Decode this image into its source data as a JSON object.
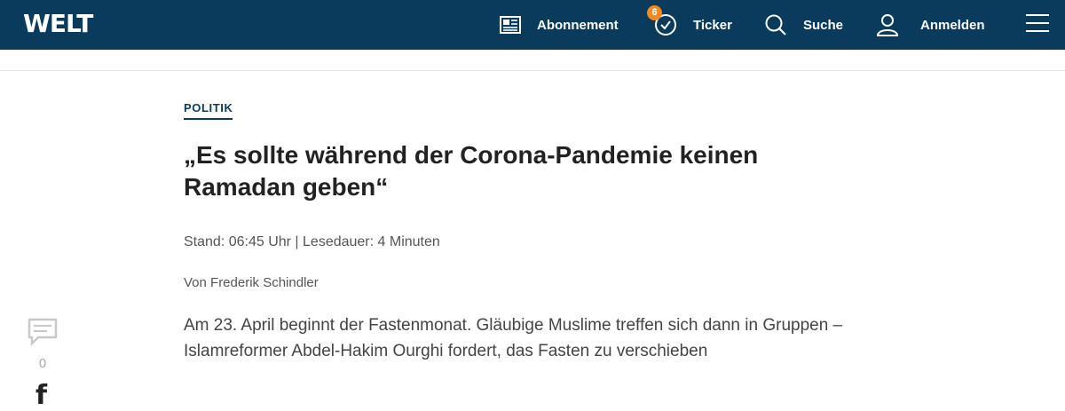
{
  "header": {
    "logo": "WELT",
    "nav": {
      "abonnement": "Abonnement",
      "ticker": "Ticker",
      "ticker_badge": "6",
      "suche": "Suche",
      "anmelden": "Anmelden"
    },
    "colors": {
      "bar": "#0a3a5c",
      "badge": "#f08a24"
    }
  },
  "article": {
    "kicker": "POLITIK",
    "headline": "„Es sollte während der Corona-Pandemie keinen Ramadan geben“",
    "meta": "Stand: 06:45 Uhr | Lesedauer: 4 Minuten",
    "author": "Von Frederik Schindler",
    "teaser": "Am 23. April beginnt der Fastenmonat. Gläubige Muslime treffen sich dann in Gruppen – Islamreformer Abdel-Hakim Ourghi fordert, das Fasten zu verschieben"
  },
  "share": {
    "comment_count": "0",
    "facebook_glyph": "f"
  }
}
